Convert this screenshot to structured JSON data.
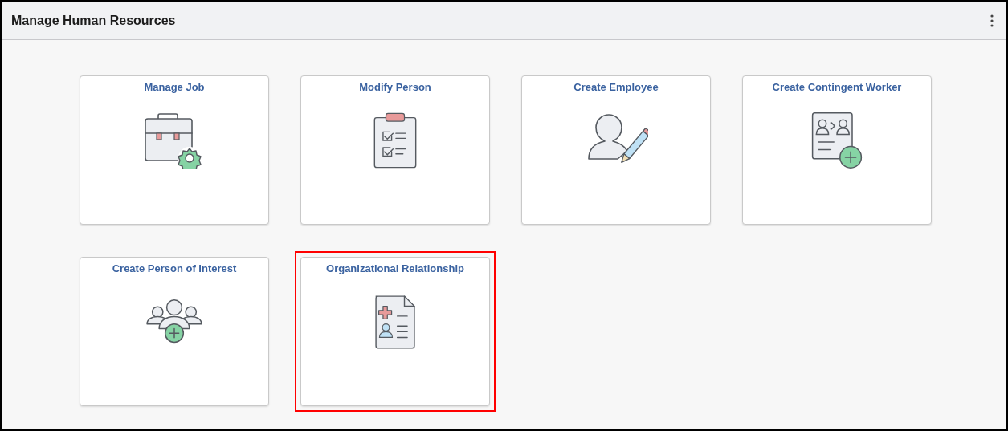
{
  "header": {
    "title": "Manage Human Resources"
  },
  "tiles": [
    {
      "label": "Manage Job",
      "kind": "briefcase-gear",
      "highlighted": false
    },
    {
      "label": "Modify Person",
      "kind": "clipboard",
      "highlighted": false
    },
    {
      "label": "Create Employee",
      "kind": "person-pencil",
      "highlighted": false
    },
    {
      "label": "Create Contingent Worker",
      "kind": "document-plus",
      "highlighted": false
    },
    {
      "label": "Create Person of Interest",
      "kind": "group-plus",
      "highlighted": false
    },
    {
      "label": "Organizational Relationship",
      "kind": "medical-document",
      "highlighted": true
    }
  ]
}
